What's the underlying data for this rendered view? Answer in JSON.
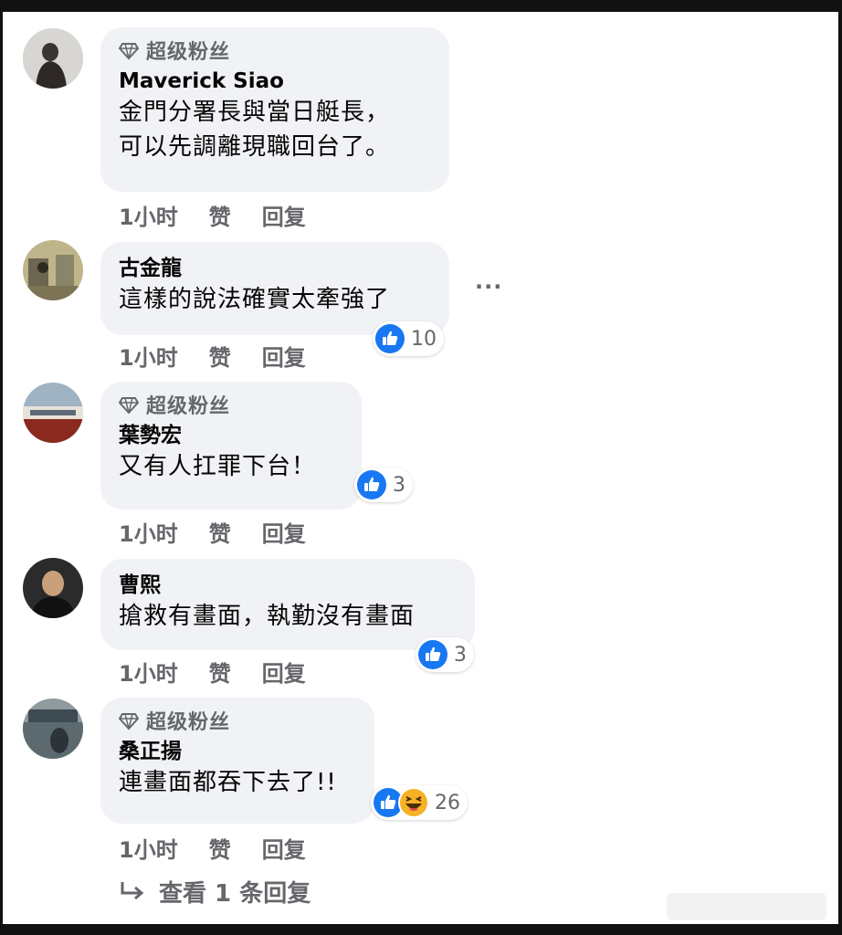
{
  "comments": [
    {
      "fan_label": "超级粉丝",
      "author": "Maverick Siao",
      "lines": [
        "金門分署長與當日艇長，",
        "可以先調離現職回台了。"
      ],
      "time": "1小时",
      "like": "赞",
      "reply": "回复",
      "reaction_count": ""
    },
    {
      "fan_label": "",
      "author": "古金龍",
      "lines": [
        "這樣的說法確實太牽強了"
      ],
      "time": "1小时",
      "like": "赞",
      "reply": "回复",
      "reaction_count": "10"
    },
    {
      "fan_label": "超级粉丝",
      "author": "葉勢宏",
      "lines": [
        "又有人扛罪下台！"
      ],
      "time": "1小时",
      "like": "赞",
      "reply": "回复",
      "reaction_count": "3"
    },
    {
      "fan_label": "",
      "author": "曹熙",
      "lines": [
        "搶救有畫面，執勤沒有畫面"
      ],
      "time": "1小时",
      "like": "赞",
      "reply": "回复",
      "reaction_count": "3"
    },
    {
      "fan_label": "超级粉丝",
      "author": "桑正揚",
      "lines": [
        "連畫面都吞下去了!!"
      ],
      "time": "1小时",
      "like": "赞",
      "reply": "回复",
      "reaction_count": "26"
    }
  ],
  "more_options": "···",
  "view_replies": "查看 1 条回复",
  "icons": {
    "fan": "diamond-icon",
    "like": "thumbs-up-icon",
    "haha": "haha-emoji-icon",
    "reply_arrow": "reply-arrow-icon",
    "more": "more-options-icon"
  },
  "colors": {
    "bubble": "#f0f2f5",
    "like_blue": "#1877f2",
    "muted": "#65676b",
    "haha_yellow": "#f7b125"
  }
}
